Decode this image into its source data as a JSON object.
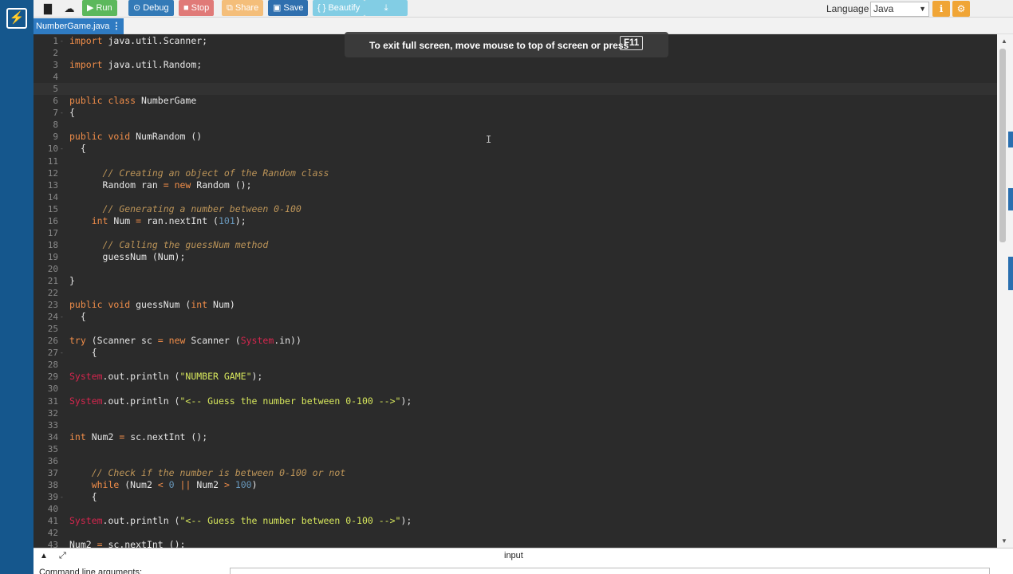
{
  "toolbar": {
    "run_label": "Run",
    "debug_label": "Debug",
    "stop_label": "Stop",
    "share_label": "Share",
    "save_label": "Save",
    "beautify_label": "{ } Beautify",
    "language_label": "Language",
    "language_value": "Java",
    "colors": {
      "run": "#5cb85c",
      "debug": "#337ab7",
      "stop": "#d9534f",
      "share": "#f0ad4e",
      "save": "#2f6fae",
      "beautify": "#5bc0de",
      "download": "#5bc0de"
    }
  },
  "tab": {
    "file_name": "NumberGame.java"
  },
  "editor": {
    "active_line": 5,
    "lines": [
      {
        "n": "1",
        "f": "-",
        "h": "<span class='kw'>import</span> java.util.Scanner;"
      },
      {
        "n": "2",
        "f": "",
        "h": ""
      },
      {
        "n": "3",
        "f": "",
        "h": "<span class='kw'>import</span> java.util.Random;"
      },
      {
        "n": "4",
        "f": "",
        "h": ""
      },
      {
        "n": "5",
        "f": "",
        "h": ""
      },
      {
        "n": "6",
        "f": "",
        "h": "<span class='kw'>public class</span> NumberGame"
      },
      {
        "n": "7",
        "f": "-",
        "h": "{"
      },
      {
        "n": "8",
        "f": "",
        "h": ""
      },
      {
        "n": "9",
        "f": "",
        "h": "<span class='kw'>public void</span> NumRandom ()"
      },
      {
        "n": "10",
        "f": "-",
        "h": "  {"
      },
      {
        "n": "11",
        "f": "",
        "h": ""
      },
      {
        "n": "12",
        "f": "",
        "h": "      <span class='cm'>// Creating an object of the Random class</span>"
      },
      {
        "n": "13",
        "f": "",
        "h": "      Random ran <span class='kw'>=</span> <span class='kw'>new</span> Random ();"
      },
      {
        "n": "14",
        "f": "",
        "h": ""
      },
      {
        "n": "15",
        "f": "",
        "h": "      <span class='cm'>// Generating a number between 0-100</span>"
      },
      {
        "n": "16",
        "f": "",
        "h": "    <span class='kw'>int</span> Num <span class='kw'>=</span> ran.nextInt (<span class='num'>101</span>);"
      },
      {
        "n": "17",
        "f": "",
        "h": ""
      },
      {
        "n": "18",
        "f": "",
        "h": "      <span class='cm'>// Calling the guessNum method</span>"
      },
      {
        "n": "19",
        "f": "",
        "h": "      guessNum (Num);"
      },
      {
        "n": "20",
        "f": "",
        "h": ""
      },
      {
        "n": "21",
        "f": "",
        "h": "}"
      },
      {
        "n": "22",
        "f": "",
        "h": ""
      },
      {
        "n": "23",
        "f": "",
        "h": "<span class='kw'>public void</span> guessNum (<span class='kw'>int</span> Num)"
      },
      {
        "n": "24",
        "f": "-",
        "h": "  {"
      },
      {
        "n": "25",
        "f": "",
        "h": ""
      },
      {
        "n": "26",
        "f": "",
        "h": "<span class='kw'>try</span> (Scanner sc <span class='kw'>=</span> <span class='kw'>new</span> Scanner (<span class='sys'>System</span>.in))"
      },
      {
        "n": "27",
        "f": "-",
        "h": "    {"
      },
      {
        "n": "28",
        "f": "",
        "h": ""
      },
      {
        "n": "29",
        "f": "",
        "h": "<span class='sys'>System</span>.out.println (<span class='str'>\"NUMBER GAME\"</span>);"
      },
      {
        "n": "30",
        "f": "",
        "h": ""
      },
      {
        "n": "31",
        "f": "",
        "h": "<span class='sys'>System</span>.out.println (<span class='str'>\"<-- Guess the number between 0-100 -->\"</span>);"
      },
      {
        "n": "32",
        "f": "",
        "h": ""
      },
      {
        "n": "33",
        "f": "",
        "h": ""
      },
      {
        "n": "34",
        "f": "",
        "h": "<span class='kw'>int</span> Num2 <span class='kw'>=</span> sc.nextInt ();"
      },
      {
        "n": "35",
        "f": "",
        "h": ""
      },
      {
        "n": "36",
        "f": "",
        "h": ""
      },
      {
        "n": "37",
        "f": "",
        "h": "    <span class='cm'>// Check if the number is between 0-100 or not</span>"
      },
      {
        "n": "38",
        "f": "",
        "h": "    <span class='kw'>while</span> (Num2 <span class='kw'>&lt;</span> <span class='num'>0</span> <span class='kw'>||</span> Num2 <span class='kw'>&gt;</span> <span class='num'>100</span>)"
      },
      {
        "n": "39",
        "f": "-",
        "h": "    {"
      },
      {
        "n": "40",
        "f": "",
        "h": ""
      },
      {
        "n": "41",
        "f": "",
        "h": "<span class='sys'>System</span>.out.println (<span class='str'>\"<-- Guess the number between 0-100 -->\"</span>);"
      },
      {
        "n": "42",
        "f": "",
        "h": ""
      },
      {
        "n": "43",
        "f": "",
        "h": "Num2 <span class='kw'>=</span> sc.nextInt ();"
      }
    ]
  },
  "fullscreen_tip": {
    "message": "To exit full screen, move mouse to top of screen or press",
    "key": "F11"
  },
  "bottom": {
    "io_label": "input",
    "cmd_label": "Command line arguments:"
  }
}
